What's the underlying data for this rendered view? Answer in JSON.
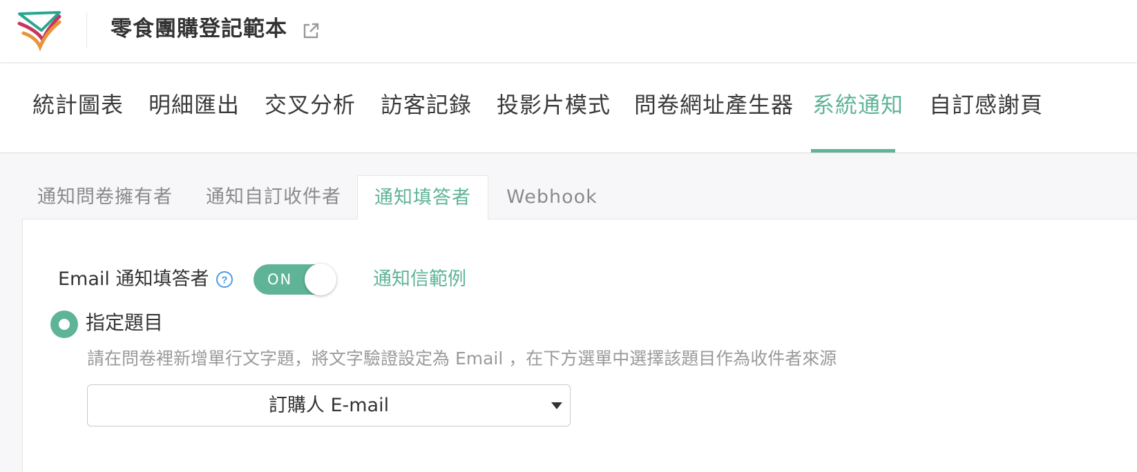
{
  "header": {
    "title": "零食團購登記範本",
    "open_icon": "external-link-icon"
  },
  "main_nav": {
    "items": [
      {
        "label": "統計圖表"
      },
      {
        "label": "明細匯出"
      },
      {
        "label": "交叉分析"
      },
      {
        "label": "訪客記錄"
      },
      {
        "label": "投影片模式"
      },
      {
        "label": "問卷網址產生器"
      },
      {
        "label": "系統通知",
        "active": true
      },
      {
        "label": "自訂感謝頁"
      }
    ]
  },
  "sub_tabs": {
    "items": [
      {
        "label": "通知問卷擁有者"
      },
      {
        "label": "通知自訂收件者"
      },
      {
        "label": "通知填答者",
        "active": true
      },
      {
        "label": "Webhook"
      }
    ]
  },
  "panel": {
    "email_label": "Email 通知填答者",
    "help_icon": "question-circle-icon",
    "toggle": {
      "text": "ON",
      "state": true
    },
    "sample_link": "通知信範例",
    "radio_label": "指定題目",
    "radio_selected": true,
    "hint": "請在問卷裡新增單行文字題，將文字驗證設定為 Email ，在下方選單中選擇該題目作為收件者來源",
    "select": {
      "value": "訂購人 E-mail",
      "caret_icon": "caret-down-icon"
    }
  },
  "colors": {
    "accent": "#5fb498",
    "logo_red": "#c7365f",
    "logo_teal": "#2aa58e",
    "logo_orange": "#e8943a"
  }
}
